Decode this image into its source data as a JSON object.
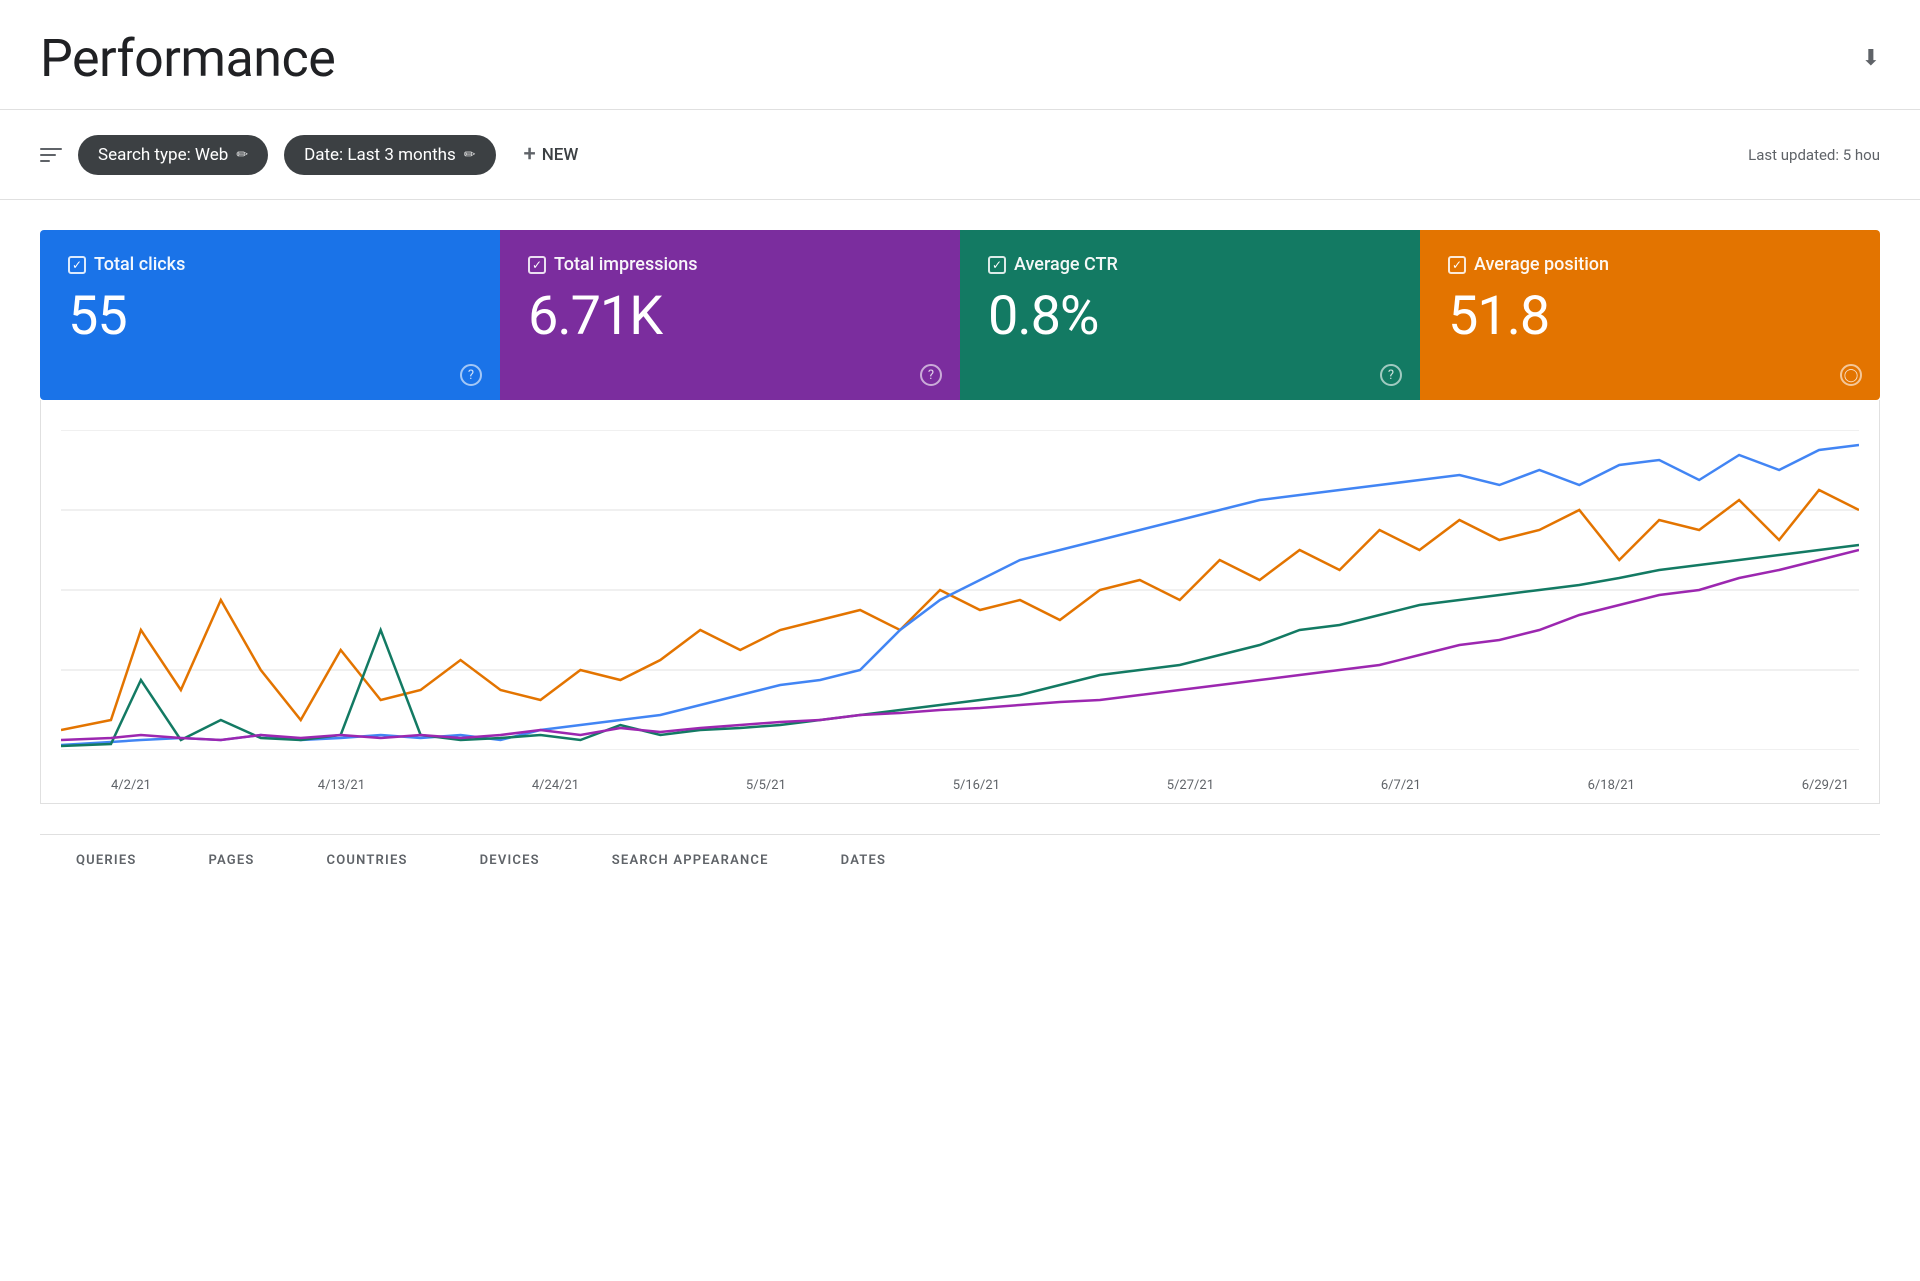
{
  "header": {
    "title": "Performance",
    "download_tooltip": "Download"
  },
  "toolbar": {
    "search_type_label": "Search type: Web",
    "date_label": "Date: Last 3 months",
    "new_button_label": "NEW",
    "last_updated": "Last updated: 5 hou"
  },
  "metrics": [
    {
      "id": "clicks",
      "label": "Total clicks",
      "value": "55",
      "color": "#1a73e8",
      "has_help": true
    },
    {
      "id": "impressions",
      "label": "Total impressions",
      "value": "6.71K",
      "color": "#7b2d9e",
      "has_help": true
    },
    {
      "id": "ctr",
      "label": "Average CTR",
      "value": "0.8%",
      "color": "#137a63",
      "has_help": true
    },
    {
      "id": "position",
      "label": "Average position",
      "value": "51.8",
      "color": "#e37400",
      "has_help": true
    }
  ],
  "chart": {
    "x_labels": [
      "4/2/21",
      "4/13/21",
      "4/24/21",
      "5/5/21",
      "5/16/21",
      "5/27/21",
      "6/7/21",
      "6/18/21",
      "6/29/21"
    ]
  },
  "bottom_tabs": [
    {
      "id": "queries",
      "label": "QUERIES"
    },
    {
      "id": "pages",
      "label": "PAGES"
    },
    {
      "id": "countries",
      "label": "COUNTRIES"
    },
    {
      "id": "devices",
      "label": "DEVICES"
    },
    {
      "id": "search-appearance",
      "label": "SEARCH APPEARANCE"
    },
    {
      "id": "dates",
      "label": "DATES"
    }
  ]
}
